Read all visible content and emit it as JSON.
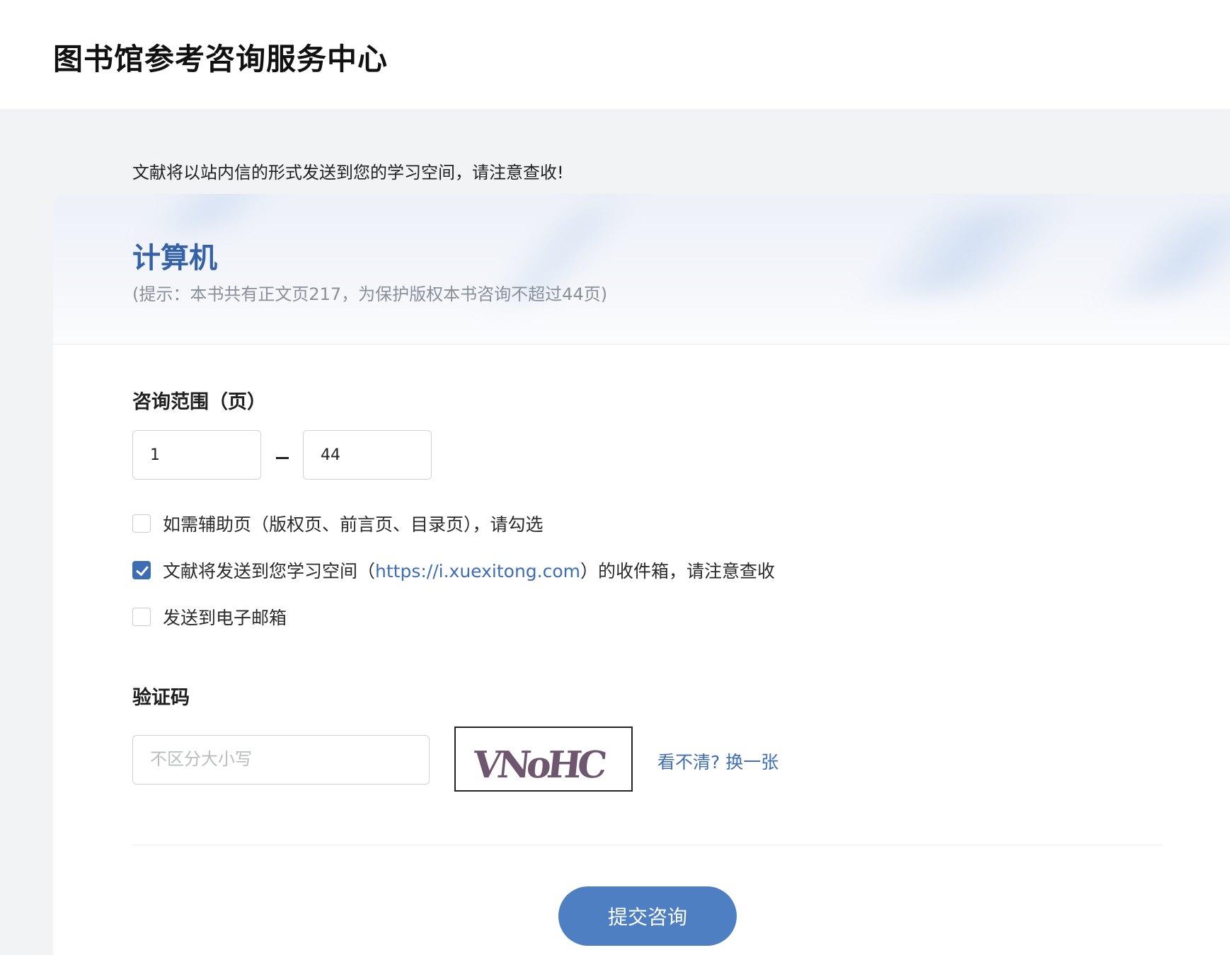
{
  "header": {
    "title": "图书馆参考咨询服务中心"
  },
  "notice": "文献将以站内信的形式发送到您的学习空间，请注意查收!",
  "book": {
    "title": "计算机",
    "hint": "(提示：本书共有正文页217，为保护版权本书咨询不超过44页)"
  },
  "range": {
    "label": "咨询范围（页）",
    "from": "1",
    "to": "44"
  },
  "options": {
    "aux_pages": {
      "label": "如需辅助页（版权页、前言页、目录页），请勾选",
      "checked": false
    },
    "send_space": {
      "label_before": "文献将发送到您学习空间（",
      "link": "https://i.xuexitong.com",
      "label_after": "）的收件箱，请注意查收",
      "checked": true
    },
    "send_email": {
      "label": "发送到电子邮箱",
      "checked": false
    }
  },
  "captcha": {
    "label": "验证码",
    "placeholder": "不区分大小写",
    "image_text": "VNoHC",
    "refresh_label": "看不清? 换一张"
  },
  "submit": {
    "label": "提交咨询"
  },
  "colors": {
    "accent": "#3e6db5",
    "button": "#4f7fc3",
    "book_title": "#3461a8"
  }
}
